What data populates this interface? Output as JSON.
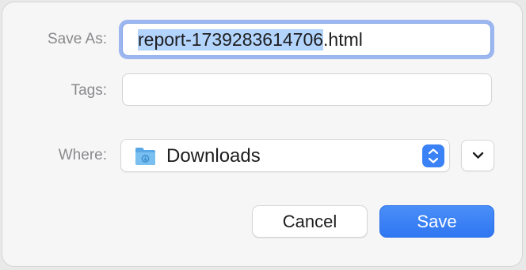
{
  "dialog": {
    "save_as_label": "Save As:",
    "filename_selected": "report-1739283614706",
    "filename_extension": ".html",
    "tags_label": "Tags:",
    "tags_value": "",
    "where_label": "Where:",
    "where_value": "Downloads",
    "where_icon": "folder-icon",
    "cancel_label": "Cancel",
    "save_label": "Save"
  },
  "colors": {
    "accent": "#3b82f6",
    "selection": "#b3d4fc",
    "focus_ring": "#9cb6ef"
  }
}
